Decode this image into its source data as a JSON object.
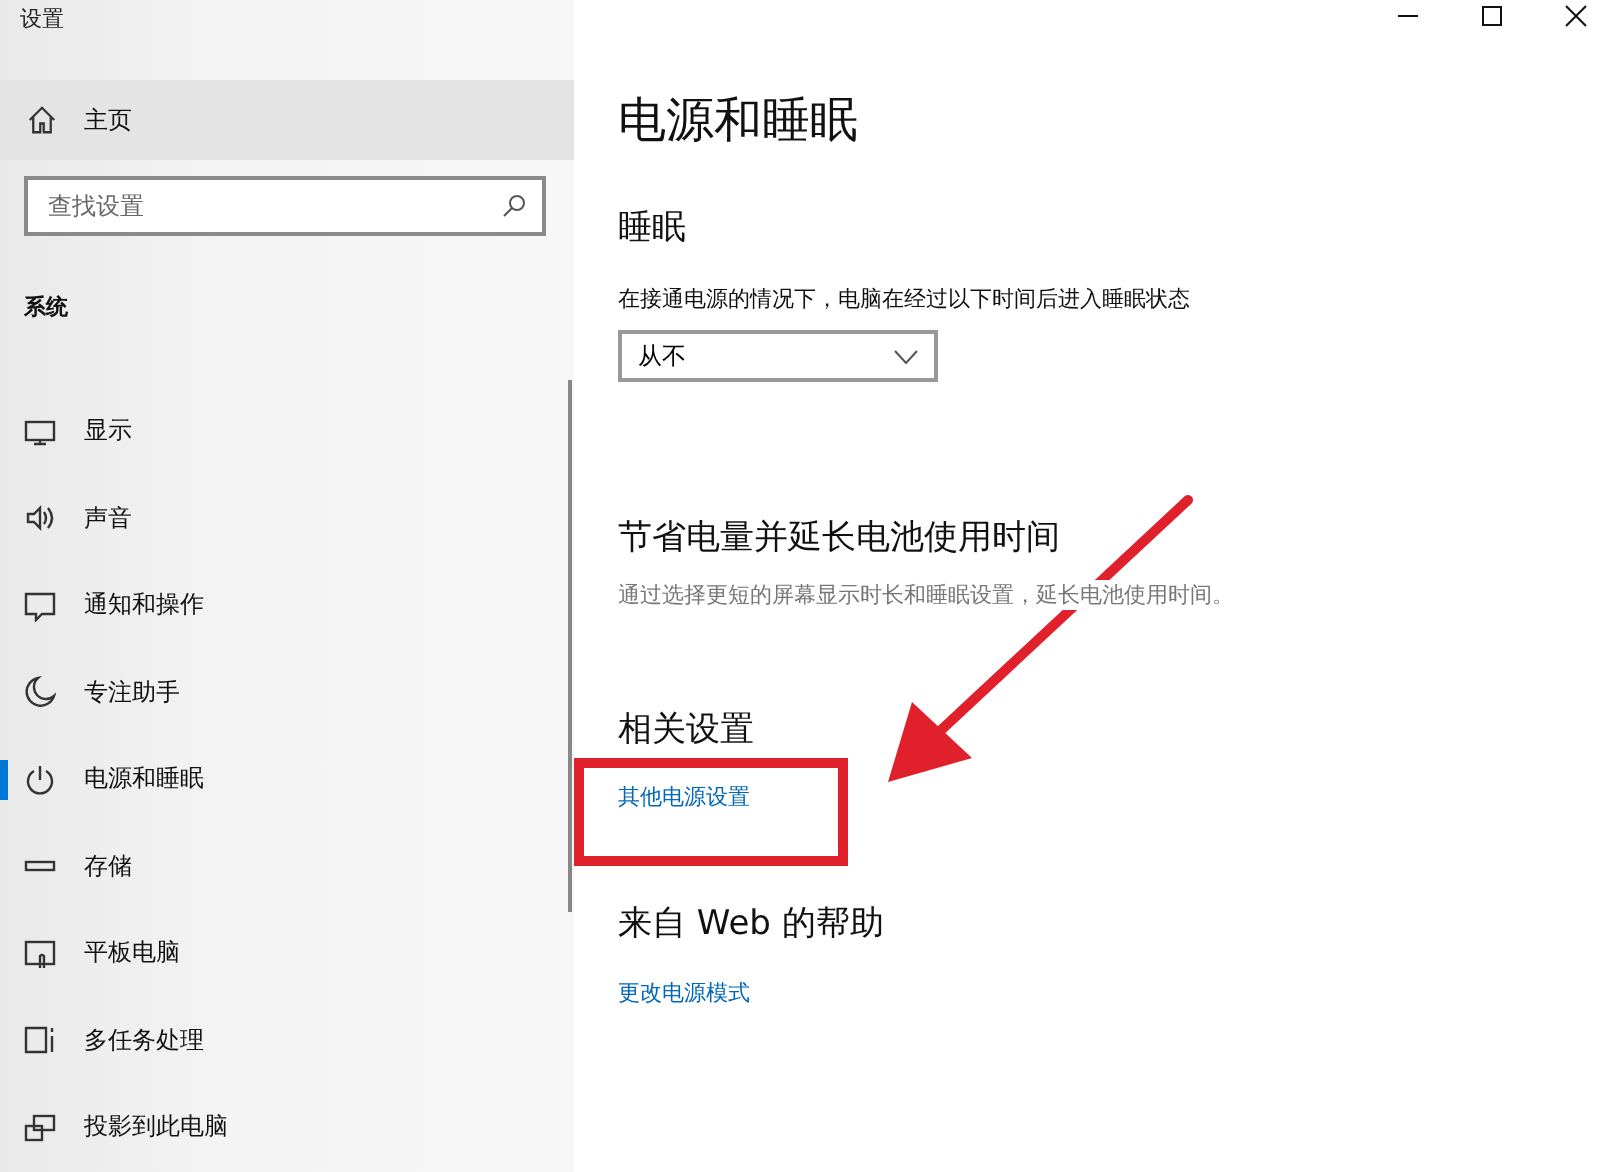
{
  "window": {
    "title": "设置"
  },
  "sidebar": {
    "home": {
      "label": "主页",
      "selected": false
    },
    "search": {
      "placeholder": "查找设置"
    },
    "section": "系统",
    "items": [
      {
        "label": "显示",
        "selected": false
      },
      {
        "label": "声音",
        "selected": false
      },
      {
        "label": "通知和操作",
        "selected": false
      },
      {
        "label": "专注助手",
        "selected": false
      },
      {
        "label": "电源和睡眠",
        "selected": true
      },
      {
        "label": "存储",
        "selected": false
      },
      {
        "label": "平板电脑",
        "selected": false
      },
      {
        "label": "多任务处理",
        "selected": false
      },
      {
        "label": "投影到此电脑",
        "selected": false
      }
    ]
  },
  "page": {
    "title": "电源和睡眠",
    "sections": [
      {
        "kind": "select",
        "heading": "睡眠",
        "label": "在接通电源的情况下，电脑在经过以下时间后进入睡眠状态",
        "value": "从不"
      },
      {
        "kind": "text",
        "heading": "节省电量并延长电池使用时间",
        "text": "通过选择更短的屏幕显示时长和睡眠设置，延长电池使用时间。"
      },
      {
        "kind": "link",
        "heading": "相关设置",
        "link": "其他电源设置",
        "highlighted": true
      },
      {
        "kind": "link",
        "heading": "来自 Web 的帮助",
        "link": "更改电源模式",
        "highlighted": false
      }
    ]
  }
}
